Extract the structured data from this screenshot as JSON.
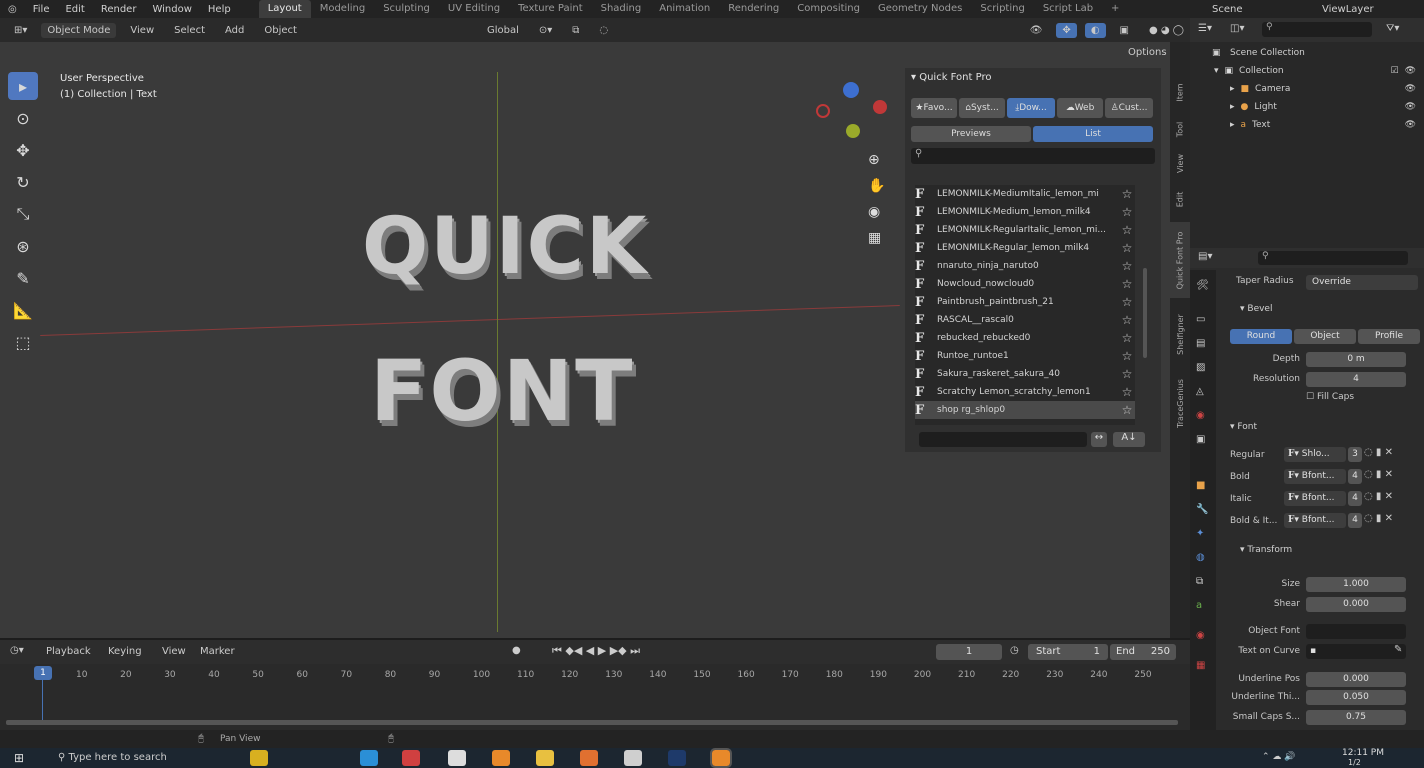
{
  "topbar": {
    "menus": [
      "File",
      "Edit",
      "Render",
      "Window",
      "Help"
    ],
    "workspaces": [
      "Layout",
      "Modeling",
      "Sculpting",
      "UV Editing",
      "Texture Paint",
      "Shading",
      "Animation",
      "Rendering",
      "Compositing",
      "Geometry Nodes",
      "Scripting",
      "Script Lab"
    ],
    "active_workspace": "Layout",
    "scene": "Scene",
    "view_layer": "ViewLayer"
  },
  "header": {
    "mode": "Object Mode",
    "menus": [
      "View",
      "Select",
      "Add",
      "Object"
    ],
    "transform": "Global",
    "options": "Options"
  },
  "viewport": {
    "perspective": "User Perspective",
    "collection": "(1) Collection | Text",
    "text_line1": "QUICK",
    "text_line2": "FONT"
  },
  "qfp": {
    "title": "Quick Font Pro",
    "buttons": [
      "Favo...",
      "Syst...",
      "Dow...",
      "Web",
      "Cust..."
    ],
    "tabs": [
      "Previews",
      "List"
    ],
    "active_tab": "List",
    "fonts": [
      "LEMONMILK-MediumItalic_lemon_mi",
      "LEMONMILK-Medium_lemon_milk4",
      "LEMONMILK-RegularItalic_lemon_mi...",
      "LEMONMILK-Regular_lemon_milk4",
      "nnaruto_ninja_naruto0",
      "Nowcloud_nowcloud0",
      "Paintbrush_paintbrush_21",
      "RASCAL__rascal0",
      "rebucked_rebucked0",
      "Runtoe_runtoe1",
      "Sakura_raskeret_sakura_40",
      "Scratchy Lemon_scratchy_lemon1",
      "shop rg_shlop0"
    ],
    "selected_index": 12
  },
  "vtabs": [
    "Item",
    "Tool",
    "View",
    "Edit",
    "Quick Font Pro",
    "Shelfigner",
    "TraceGenius"
  ],
  "outliner": {
    "root": "Scene Collection",
    "items": [
      "Collection",
      "Camera",
      "Light",
      "Text"
    ]
  },
  "props": {
    "taper_label": "Taper Radius",
    "taper_value": "Override",
    "bevel_title": "Bevel",
    "bevel_tabs": [
      "Round",
      "Object",
      "Profile"
    ],
    "depth_label": "Depth",
    "depth_value": "0 m",
    "resolution_label": "Resolution",
    "resolution_value": "4",
    "fill_caps": "Fill Caps",
    "font_title": "Font",
    "font_rows": [
      {
        "label": "Regular",
        "name": "Shlo...",
        "users": "3"
      },
      {
        "label": "Bold",
        "name": "Bfont...",
        "users": "4"
      },
      {
        "label": "Italic",
        "name": "Bfont...",
        "users": "4"
      },
      {
        "label": "Bold & It...",
        "name": "Bfont...",
        "users": "4"
      }
    ],
    "transform_title": "Transform",
    "size_label": "Size",
    "size_value": "1.000",
    "shear_label": "Shear",
    "shear_value": "0.000",
    "object_font": "Object Font",
    "text_on_curve": "Text on Curve",
    "underline_pos_label": "Underline Pos",
    "underline_pos_value": "0.000",
    "underline_thick_label": "Underline Thi...",
    "underline_thick_value": "0.050",
    "small_caps_label": "Small Caps S...",
    "small_caps_value": "0.75"
  },
  "timeline": {
    "menus": [
      "Playback",
      "Keying",
      "View",
      "Marker"
    ],
    "current_frame": "1",
    "start_label": "Start",
    "start": "1",
    "end_label": "End",
    "end": "250",
    "ticks": [
      "1",
      "10",
      "20",
      "30",
      "40",
      "50",
      "60",
      "70",
      "80",
      "90",
      "100",
      "110",
      "120",
      "130",
      "140",
      "150",
      "160",
      "170",
      "180",
      "190",
      "200",
      "210",
      "220",
      "230",
      "240",
      "250"
    ]
  },
  "status": {
    "pan": "Pan View"
  },
  "taskbar": {
    "search_placeholder": "Type here to search",
    "time": "12:11 PM",
    "date": "1/2"
  }
}
